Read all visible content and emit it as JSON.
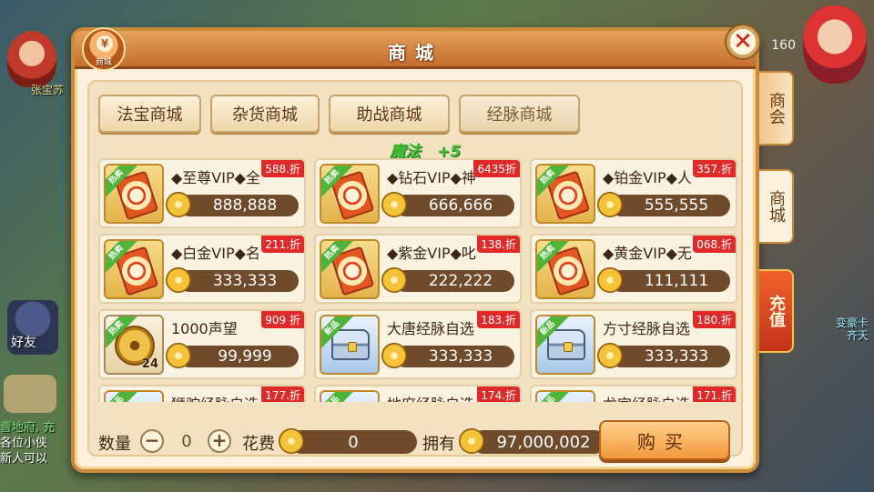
{
  "background": {
    "left_label": "张宝苏",
    "level": "160",
    "friend_label": "好友",
    "chat_lines": [
      "曹地府, 充",
      "各位小侠",
      "新人可以"
    ],
    "right_text": [
      "变豪卡",
      "齐天"
    ]
  },
  "panel": {
    "title": "商城",
    "badge_label": "商城",
    "badge_glyph": "¥",
    "close_icon": "✕"
  },
  "tabs": [
    {
      "label": "法宝商城"
    },
    {
      "label": "杂货商城"
    },
    {
      "label": "助战商城"
    },
    {
      "label": "经脉商城"
    }
  ],
  "magic_notice": {
    "label": "魔法",
    "amount": "+5"
  },
  "items": [
    {
      "name": "◆至尊VIP◆全",
      "price": "888,888",
      "discount": "588.折",
      "tag": "热卖",
      "icon": "ticket"
    },
    {
      "name": "◆钻石VIP◆神",
      "price": "666,666",
      "discount": "6435折",
      "tag": "热卖",
      "icon": "ticket"
    },
    {
      "name": "◆铂金VIP◆人",
      "price": "555,555",
      "discount": "357.折",
      "tag": "热卖",
      "icon": "ticket"
    },
    {
      "name": "◆白金VIP◆名",
      "price": "333,333",
      "discount": "211.折",
      "tag": "热卖",
      "icon": "ticket"
    },
    {
      "name": "◆紫金VIP◆叱",
      "price": "222,222",
      "discount": "138.折",
      "tag": "热卖",
      "icon": "ticket"
    },
    {
      "name": "◆黄金VIP◆无",
      "price": "111,111",
      "discount": "068.折",
      "tag": "热卖",
      "icon": "ticket"
    },
    {
      "name": "1000声望",
      "price": "99,999",
      "discount": "909 折",
      "tag": "热卖",
      "icon": "coin",
      "qty": "24"
    },
    {
      "name": "大唐经脉自选",
      "price": "333,333",
      "discount": "183.折",
      "tag": "新品",
      "icon": "chest"
    },
    {
      "name": "方寸经脉自选",
      "price": "333,333",
      "discount": "180.折",
      "tag": "新品",
      "icon": "chest"
    },
    {
      "name": "狮驼经脉自选",
      "price": "",
      "discount": "177.折",
      "tag": "新品",
      "icon": "chest"
    },
    {
      "name": "地府经脉自选",
      "price": "",
      "discount": "174.折",
      "tag": "新品",
      "icon": "chest"
    },
    {
      "name": "龙宫经脉自选",
      "price": "",
      "discount": "171.折",
      "tag": "新品",
      "icon": "chest"
    }
  ],
  "bottom": {
    "qty_label": "数量",
    "qty_value": "0",
    "minus": "−",
    "plus": "+",
    "cost_label": "花费",
    "cost_value": "0",
    "own_label": "拥有",
    "own_value": "97,000,002",
    "buy_label": "购买"
  },
  "side_tabs": [
    {
      "label": "商会"
    },
    {
      "label": "商城"
    },
    {
      "label": "充值"
    }
  ]
}
